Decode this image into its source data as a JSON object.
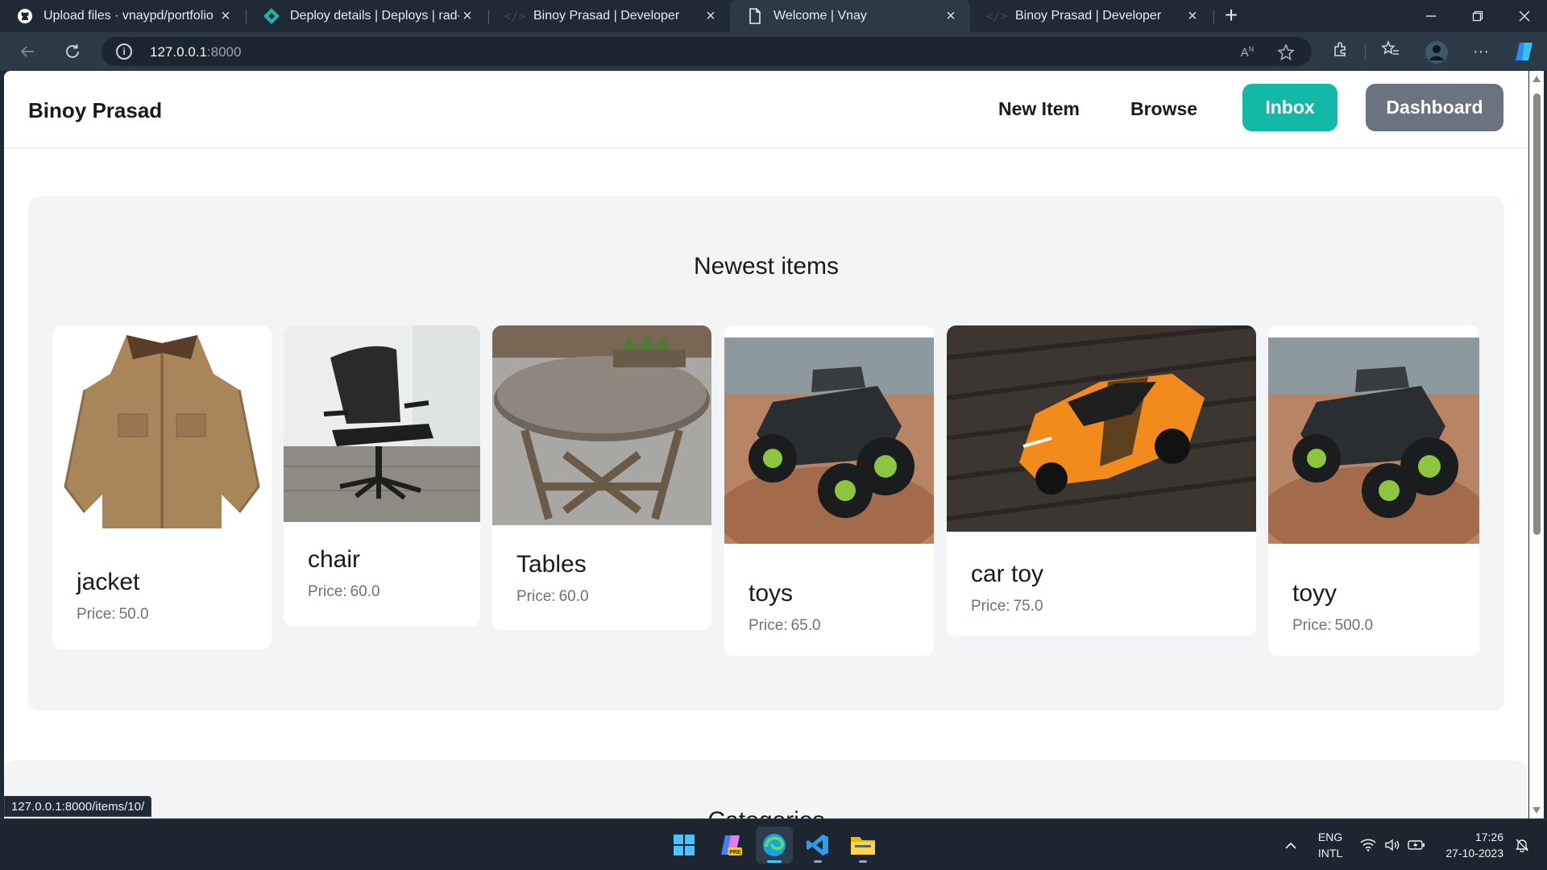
{
  "browser": {
    "tabs": [
      {
        "title": "Upload files · vnaypd/portfolio",
        "icon": "github-icon",
        "active": false
      },
      {
        "title": "Deploy details | Deploys | rad-cri",
        "icon": "netlify-icon",
        "active": false
      },
      {
        "title": "Binoy Prasad | Developer",
        "icon": "code-icon",
        "active": false
      },
      {
        "title": "Welcome | Vnay",
        "icon": "page-icon",
        "active": true
      },
      {
        "title": "Binoy Prasad | Developer",
        "icon": "code-icon",
        "active": false
      }
    ],
    "url_host": "127.0.0.1",
    "url_port": ":8000",
    "status_url": "127.0.0.1:8000/items/10/"
  },
  "site": {
    "brand": "Binoy Prasad",
    "nav": {
      "new_item": "New Item",
      "browse": "Browse",
      "inbox": "Inbox",
      "dashboard": "Dashboard"
    },
    "colors": {
      "inbox": "#14b8a6",
      "dashboard": "#6b7280",
      "section_bg": "#f3f4f6"
    },
    "newest_heading": "Newest items",
    "items": [
      {
        "name": "jacket",
        "price_label": "Price:",
        "price": "50.0",
        "image": "brown-jacket"
      },
      {
        "name": "chair",
        "price_label": "Price:",
        "price": "60.0",
        "image": "office-chair"
      },
      {
        "name": "Tables",
        "price_label": "Price:",
        "price": "60.0",
        "image": "round-wood-table"
      },
      {
        "name": "toys",
        "price_label": "Price:",
        "price": "65.0",
        "image": "rc-crawler-truck"
      },
      {
        "name": "car toy",
        "price_label": "Price:",
        "price": "75.0",
        "image": "orange-sports-car"
      },
      {
        "name": "toyy",
        "price_label": "Price:",
        "price": "500.0",
        "image": "rc-crawler-truck"
      }
    ],
    "categories_heading": "Categories"
  },
  "taskbar": {
    "lang_1": "ENG",
    "lang_2": "INTL",
    "time": "17:26",
    "date": "27-10-2023"
  }
}
